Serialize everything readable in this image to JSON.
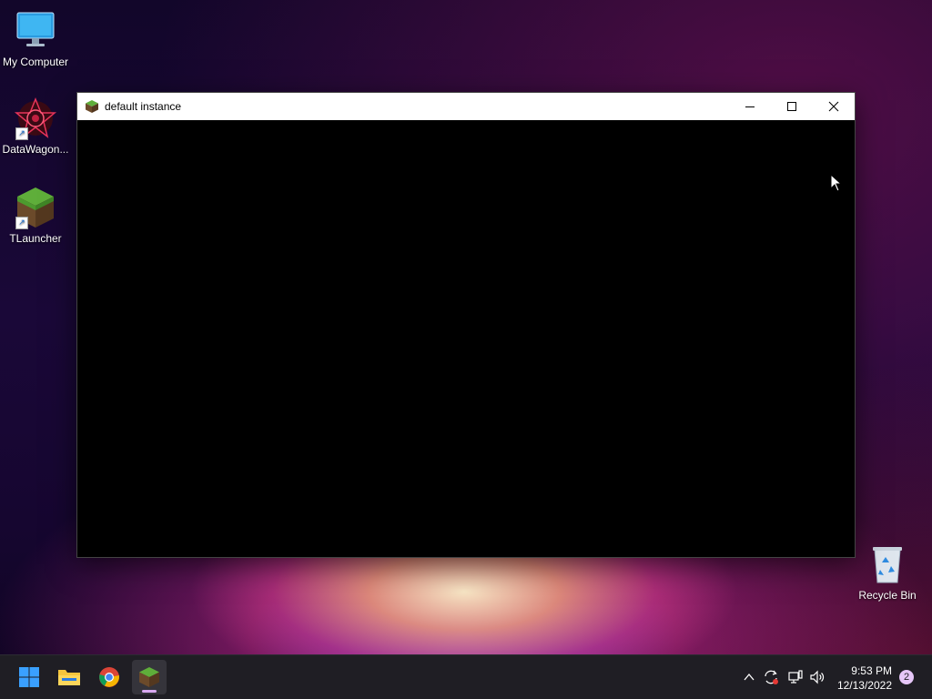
{
  "desktop": {
    "icons": [
      {
        "label": "My Computer",
        "icon": "monitor-icon"
      },
      {
        "label": "DataWagon...",
        "icon": "datawagon-icon",
        "shortcut": true
      },
      {
        "label": "TLauncher",
        "icon": "minecraft-grass-block-icon",
        "shortcut": true
      },
      {
        "label": "Recycle Bin",
        "icon": "recycle-bin-icon"
      }
    ]
  },
  "window": {
    "title": "default instance",
    "icon": "minecraft-grass-block-icon",
    "controls": [
      "minimize",
      "maximize",
      "close"
    ]
  },
  "taskbar": {
    "apps": [
      {
        "name": "start",
        "icon": "windows-logo-icon"
      },
      {
        "name": "file-explorer",
        "icon": "folder-icon"
      },
      {
        "name": "chrome",
        "icon": "chrome-icon"
      },
      {
        "name": "minecraft",
        "icon": "minecraft-grass-block-icon",
        "active": true
      }
    ],
    "tray": {
      "icons": [
        "chevron-up-icon",
        "sync-icon",
        "network-icon",
        "volume-icon"
      ],
      "time": "9:53 PM",
      "date": "12/13/2022",
      "notification_count": "2"
    }
  },
  "colors": {
    "window_bg": "#000000",
    "titlebar_bg": "#ffffff",
    "taskbar_bg": "#1f1e24",
    "accent": "#d8a8f0"
  }
}
